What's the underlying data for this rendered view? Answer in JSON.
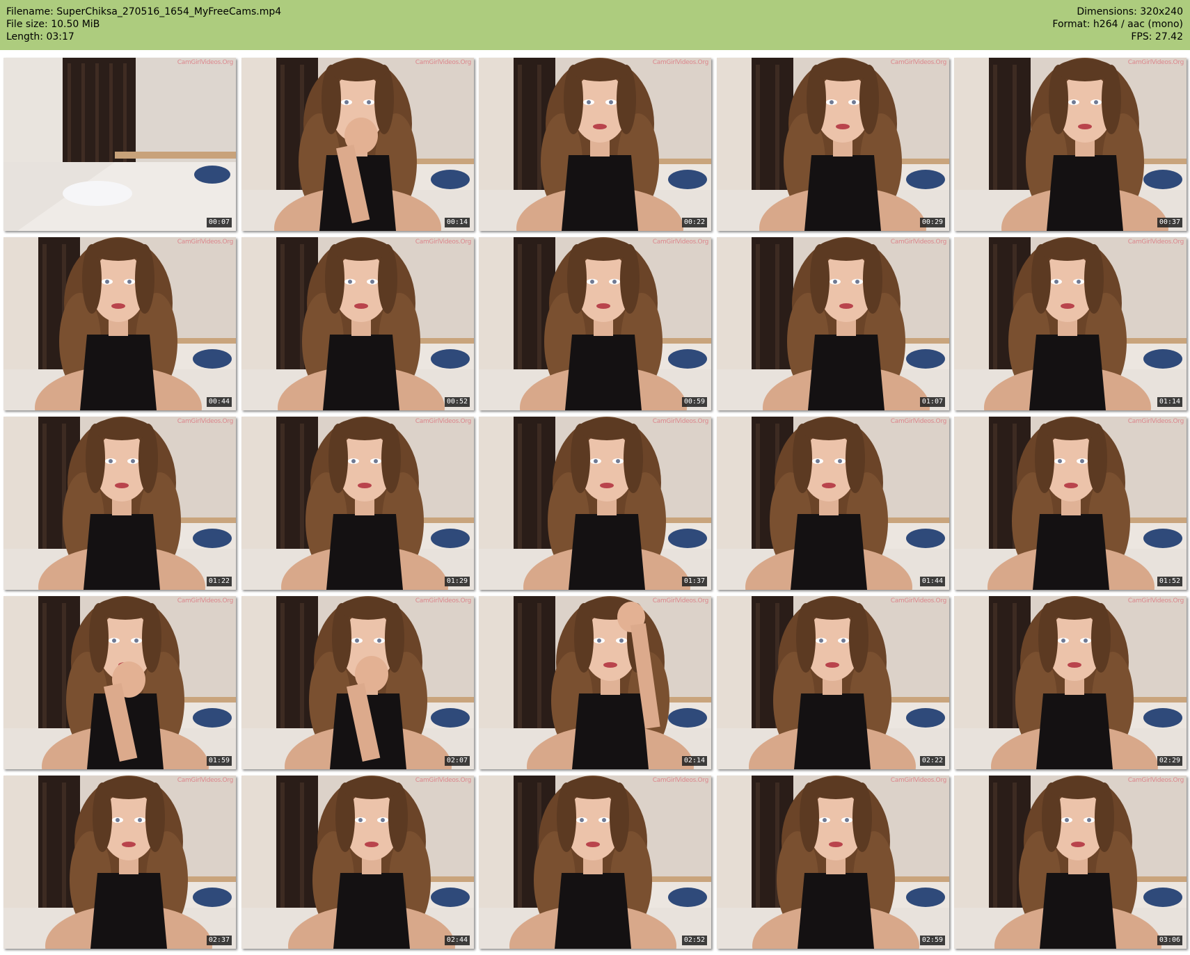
{
  "header": {
    "filename_line": "Filename: SuperChiksa_270516_1654_MyFreeCams.mp4",
    "filesize_line": "File size: 10.50 MiB",
    "length_line": "Length: 03:17",
    "dimensions_line": "Dimensions: 320x240",
    "format_line": "Format: h264 / aac (mono)",
    "fps_line": "FPS: 27.42",
    "background_color": "#adcc7e"
  },
  "watermark": "CamGirlVideos.Org",
  "thumbnails": [
    {
      "time": "00:07",
      "scene": "empty-room"
    },
    {
      "time": "00:14",
      "scene": "hand-at-mouth"
    },
    {
      "time": "00:22",
      "scene": "portrait"
    },
    {
      "time": "00:29",
      "scene": "portrait"
    },
    {
      "time": "00:37",
      "scene": "portrait"
    },
    {
      "time": "00:44",
      "scene": "portrait-looking-down"
    },
    {
      "time": "00:52",
      "scene": "portrait"
    },
    {
      "time": "00:59",
      "scene": "portrait"
    },
    {
      "time": "01:07",
      "scene": "portrait-smiling"
    },
    {
      "time": "01:14",
      "scene": "portrait"
    },
    {
      "time": "01:22",
      "scene": "portrait"
    },
    {
      "time": "01:29",
      "scene": "portrait"
    },
    {
      "time": "01:37",
      "scene": "portrait"
    },
    {
      "time": "01:44",
      "scene": "portrait"
    },
    {
      "time": "01:52",
      "scene": "portrait"
    },
    {
      "time": "01:59",
      "scene": "hand-at-chin"
    },
    {
      "time": "02:07",
      "scene": "hand-at-mouth"
    },
    {
      "time": "02:14",
      "scene": "hand-on-head"
    },
    {
      "time": "02:22",
      "scene": "portrait"
    },
    {
      "time": "02:29",
      "scene": "portrait"
    },
    {
      "time": "02:37",
      "scene": "portrait"
    },
    {
      "time": "02:44",
      "scene": "portrait"
    },
    {
      "time": "02:52",
      "scene": "portrait"
    },
    {
      "time": "02:59",
      "scene": "portrait"
    },
    {
      "time": "03:06",
      "scene": "portrait"
    }
  ]
}
